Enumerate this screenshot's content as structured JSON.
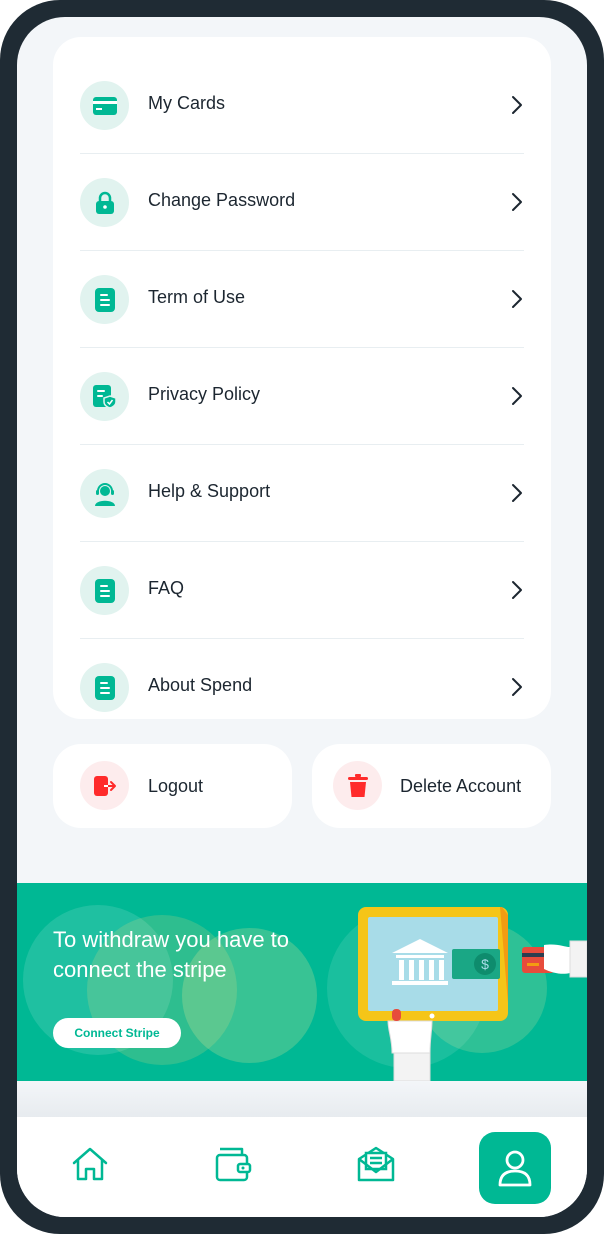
{
  "colors": {
    "accent": "#00b894",
    "danger": "#ff2b2b",
    "icon_bg": "#e1f3ef",
    "danger_bg": "#fdeced"
  },
  "menu": {
    "items": [
      {
        "label": "My Cards",
        "icon": "card-icon"
      },
      {
        "label": "Change Password",
        "icon": "lock-icon"
      },
      {
        "label": "Term of Use",
        "icon": "document-icon"
      },
      {
        "label": "Privacy Policy",
        "icon": "privacy-document-icon"
      },
      {
        "label": "Help & Support",
        "icon": "support-agent-icon"
      },
      {
        "label": "FAQ",
        "icon": "document-icon"
      },
      {
        "label": "About Spend",
        "icon": "document-icon"
      }
    ]
  },
  "actions": {
    "logout_label": "Logout",
    "delete_label": "Delete Account"
  },
  "banner": {
    "text": "To withdraw you have to connect the stripe",
    "button_label": "Connect Stripe"
  },
  "tabs": [
    {
      "name": "home-icon",
      "active": false
    },
    {
      "name": "wallet-icon",
      "active": false
    },
    {
      "name": "mail-icon",
      "active": false
    },
    {
      "name": "profile-icon",
      "active": true
    }
  ]
}
